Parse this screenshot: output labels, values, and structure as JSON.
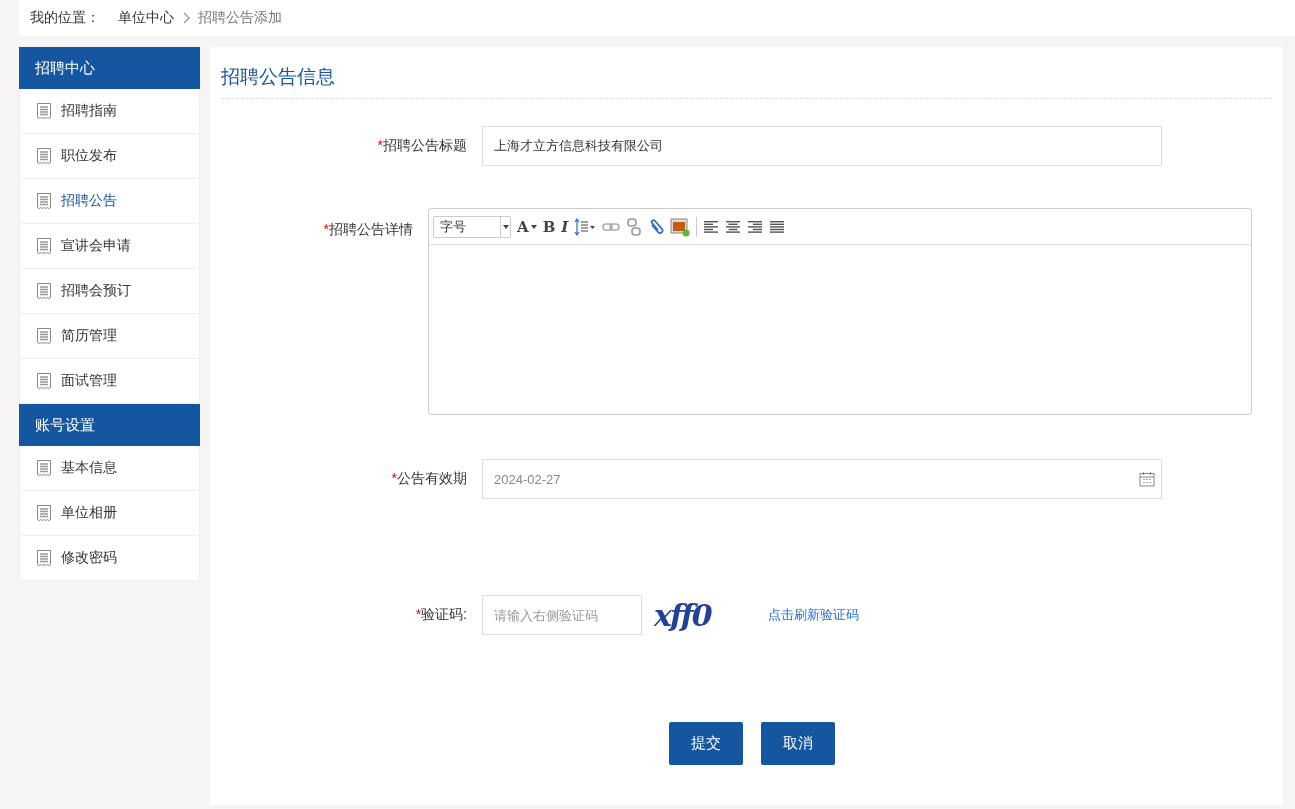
{
  "breadcrumb": {
    "label": "我的位置：",
    "items": [
      {
        "text": "单位中心",
        "current": false
      },
      {
        "text": "招聘公告添加",
        "current": true
      }
    ]
  },
  "sidebar": {
    "groups": [
      {
        "title": "招聘中心",
        "items": [
          {
            "label": "招聘指南",
            "selected": false
          },
          {
            "label": "职位发布",
            "selected": false
          },
          {
            "label": "招聘公告",
            "selected": true
          },
          {
            "label": "宣讲会申请",
            "selected": false
          },
          {
            "label": "招聘会预订",
            "selected": false
          },
          {
            "label": "简历管理",
            "selected": false
          },
          {
            "label": "面试管理",
            "selected": false
          }
        ]
      },
      {
        "title": "账号设置",
        "items": [
          {
            "label": "基本信息",
            "selected": false
          },
          {
            "label": "单位相册",
            "selected": false
          },
          {
            "label": "修改密码",
            "selected": false
          }
        ]
      }
    ]
  },
  "section_title": "招聘公告信息",
  "form": {
    "title_field": {
      "required_mark": "*",
      "label": "招聘公告标题",
      "value": "上海才立方信息科技有限公司"
    },
    "detail_editor": {
      "required_mark": "*",
      "label": "招聘公告详情",
      "font_size_select": "字号",
      "tools": [
        {
          "kind": "font-color",
          "text": "A"
        },
        {
          "kind": "bold",
          "text": "B"
        },
        {
          "kind": "italic",
          "text": "I"
        },
        {
          "kind": "line-height"
        },
        {
          "kind": "link"
        },
        {
          "kind": "unlink"
        },
        {
          "kind": "attachment"
        },
        {
          "kind": "image"
        },
        {
          "kind": "separator"
        },
        {
          "kind": "align-left"
        },
        {
          "kind": "align-center"
        },
        {
          "kind": "align-right"
        },
        {
          "kind": "justify"
        }
      ]
    },
    "expiry_field": {
      "required_mark": "*",
      "label": "公告有效期",
      "value": "2024-02-27"
    },
    "captcha": {
      "required_mark": "*",
      "label": "验证码:",
      "placeholder": "请输入右侧验证码",
      "captcha_text": "xff0",
      "refresh_link": "点击刷新验证码"
    },
    "buttons": [
      {
        "label": "提交"
      },
      {
        "label": "取消"
      }
    ]
  }
}
